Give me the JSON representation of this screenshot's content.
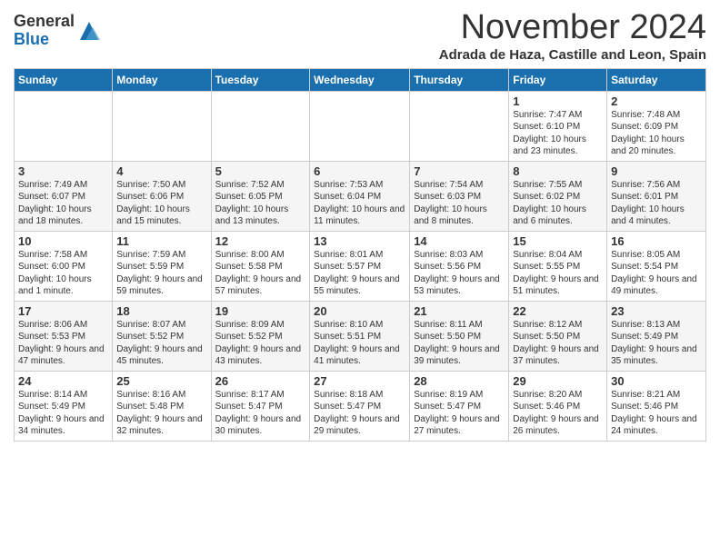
{
  "header": {
    "logo_general": "General",
    "logo_blue": "Blue",
    "month": "November 2024",
    "location": "Adrada de Haza, Castille and Leon, Spain"
  },
  "weekdays": [
    "Sunday",
    "Monday",
    "Tuesday",
    "Wednesday",
    "Thursday",
    "Friday",
    "Saturday"
  ],
  "weeks": [
    [
      {
        "day": "",
        "info": ""
      },
      {
        "day": "",
        "info": ""
      },
      {
        "day": "",
        "info": ""
      },
      {
        "day": "",
        "info": ""
      },
      {
        "day": "",
        "info": ""
      },
      {
        "day": "1",
        "info": "Sunrise: 7:47 AM\nSunset: 6:10 PM\nDaylight: 10 hours and 23 minutes."
      },
      {
        "day": "2",
        "info": "Sunrise: 7:48 AM\nSunset: 6:09 PM\nDaylight: 10 hours and 20 minutes."
      }
    ],
    [
      {
        "day": "3",
        "info": "Sunrise: 7:49 AM\nSunset: 6:07 PM\nDaylight: 10 hours and 18 minutes."
      },
      {
        "day": "4",
        "info": "Sunrise: 7:50 AM\nSunset: 6:06 PM\nDaylight: 10 hours and 15 minutes."
      },
      {
        "day": "5",
        "info": "Sunrise: 7:52 AM\nSunset: 6:05 PM\nDaylight: 10 hours and 13 minutes."
      },
      {
        "day": "6",
        "info": "Sunrise: 7:53 AM\nSunset: 6:04 PM\nDaylight: 10 hours and 11 minutes."
      },
      {
        "day": "7",
        "info": "Sunrise: 7:54 AM\nSunset: 6:03 PM\nDaylight: 10 hours and 8 minutes."
      },
      {
        "day": "8",
        "info": "Sunrise: 7:55 AM\nSunset: 6:02 PM\nDaylight: 10 hours and 6 minutes."
      },
      {
        "day": "9",
        "info": "Sunrise: 7:56 AM\nSunset: 6:01 PM\nDaylight: 10 hours and 4 minutes."
      }
    ],
    [
      {
        "day": "10",
        "info": "Sunrise: 7:58 AM\nSunset: 6:00 PM\nDaylight: 10 hours and 1 minute."
      },
      {
        "day": "11",
        "info": "Sunrise: 7:59 AM\nSunset: 5:59 PM\nDaylight: 9 hours and 59 minutes."
      },
      {
        "day": "12",
        "info": "Sunrise: 8:00 AM\nSunset: 5:58 PM\nDaylight: 9 hours and 57 minutes."
      },
      {
        "day": "13",
        "info": "Sunrise: 8:01 AM\nSunset: 5:57 PM\nDaylight: 9 hours and 55 minutes."
      },
      {
        "day": "14",
        "info": "Sunrise: 8:03 AM\nSunset: 5:56 PM\nDaylight: 9 hours and 53 minutes."
      },
      {
        "day": "15",
        "info": "Sunrise: 8:04 AM\nSunset: 5:55 PM\nDaylight: 9 hours and 51 minutes."
      },
      {
        "day": "16",
        "info": "Sunrise: 8:05 AM\nSunset: 5:54 PM\nDaylight: 9 hours and 49 minutes."
      }
    ],
    [
      {
        "day": "17",
        "info": "Sunrise: 8:06 AM\nSunset: 5:53 PM\nDaylight: 9 hours and 47 minutes."
      },
      {
        "day": "18",
        "info": "Sunrise: 8:07 AM\nSunset: 5:52 PM\nDaylight: 9 hours and 45 minutes."
      },
      {
        "day": "19",
        "info": "Sunrise: 8:09 AM\nSunset: 5:52 PM\nDaylight: 9 hours and 43 minutes."
      },
      {
        "day": "20",
        "info": "Sunrise: 8:10 AM\nSunset: 5:51 PM\nDaylight: 9 hours and 41 minutes."
      },
      {
        "day": "21",
        "info": "Sunrise: 8:11 AM\nSunset: 5:50 PM\nDaylight: 9 hours and 39 minutes."
      },
      {
        "day": "22",
        "info": "Sunrise: 8:12 AM\nSunset: 5:50 PM\nDaylight: 9 hours and 37 minutes."
      },
      {
        "day": "23",
        "info": "Sunrise: 8:13 AM\nSunset: 5:49 PM\nDaylight: 9 hours and 35 minutes."
      }
    ],
    [
      {
        "day": "24",
        "info": "Sunrise: 8:14 AM\nSunset: 5:49 PM\nDaylight: 9 hours and 34 minutes."
      },
      {
        "day": "25",
        "info": "Sunrise: 8:16 AM\nSunset: 5:48 PM\nDaylight: 9 hours and 32 minutes."
      },
      {
        "day": "26",
        "info": "Sunrise: 8:17 AM\nSunset: 5:47 PM\nDaylight: 9 hours and 30 minutes."
      },
      {
        "day": "27",
        "info": "Sunrise: 8:18 AM\nSunset: 5:47 PM\nDaylight: 9 hours and 29 minutes."
      },
      {
        "day": "28",
        "info": "Sunrise: 8:19 AM\nSunset: 5:47 PM\nDaylight: 9 hours and 27 minutes."
      },
      {
        "day": "29",
        "info": "Sunrise: 8:20 AM\nSunset: 5:46 PM\nDaylight: 9 hours and 26 minutes."
      },
      {
        "day": "30",
        "info": "Sunrise: 8:21 AM\nSunset: 5:46 PM\nDaylight: 9 hours and 24 minutes."
      }
    ]
  ]
}
